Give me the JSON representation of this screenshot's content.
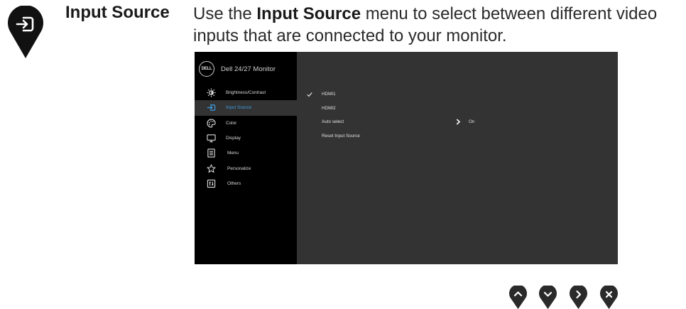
{
  "heading": {
    "label": "Input Source",
    "desc_pre": "Use the ",
    "desc_bold": "Input Source",
    "desc_post": " menu to select between different video inputs that are connected to your monitor."
  },
  "osd": {
    "logo_text": "DELL",
    "title": "Dell 24/27 Monitor",
    "menu": [
      {
        "label": "Brightness/Contrast",
        "icon": "brightness-icon"
      },
      {
        "label": "Input Source",
        "icon": "input-source-icon",
        "active": true
      },
      {
        "label": "Color",
        "icon": "color-palette-icon"
      },
      {
        "label": "Display",
        "icon": "display-icon"
      },
      {
        "label": "Menu",
        "icon": "menu-icon"
      },
      {
        "label": "Personalize",
        "icon": "star-icon"
      },
      {
        "label": "Others",
        "icon": "others-icon"
      }
    ],
    "options": [
      {
        "label": "HDMI1",
        "checked": true
      },
      {
        "label": "HDMI2"
      },
      {
        "label": "Auto select",
        "value": "On"
      },
      {
        "label": "Reset Input Source"
      }
    ]
  },
  "colors": {
    "accent": "#3d9be0",
    "osd_bg": "#333333",
    "sidebar_bg": "#000000"
  },
  "nav_buttons": [
    "up-icon",
    "down-icon",
    "right-icon",
    "close-icon"
  ]
}
